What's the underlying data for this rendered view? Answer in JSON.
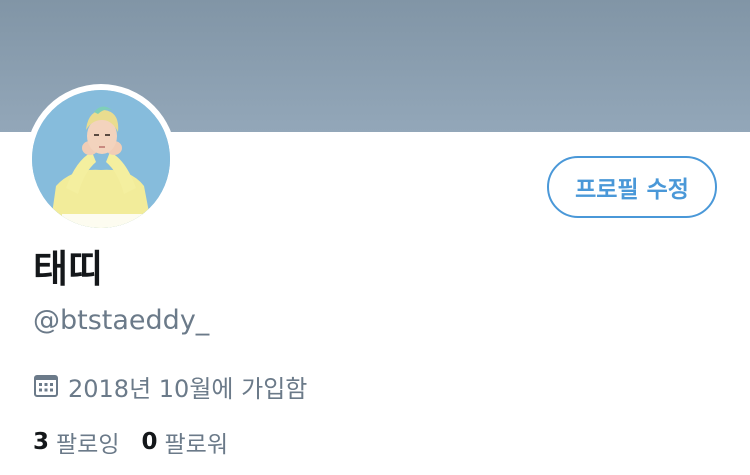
{
  "profile": {
    "display_name": "태띠",
    "handle": "@btstaeddy_",
    "joined": "2018년 10월에 가입함",
    "edit_button_label": "프로필 수정"
  },
  "stats": {
    "following_count": "3",
    "following_label": "팔로잉",
    "followers_count": "0",
    "followers_label": "팔로워"
  },
  "icons": {
    "calendar": "calendar-icon"
  },
  "colors": {
    "banner": "#8a9eb0",
    "accent": "#4a98d8",
    "secondary_text": "#6b7a89",
    "primary_text": "#14171a"
  }
}
